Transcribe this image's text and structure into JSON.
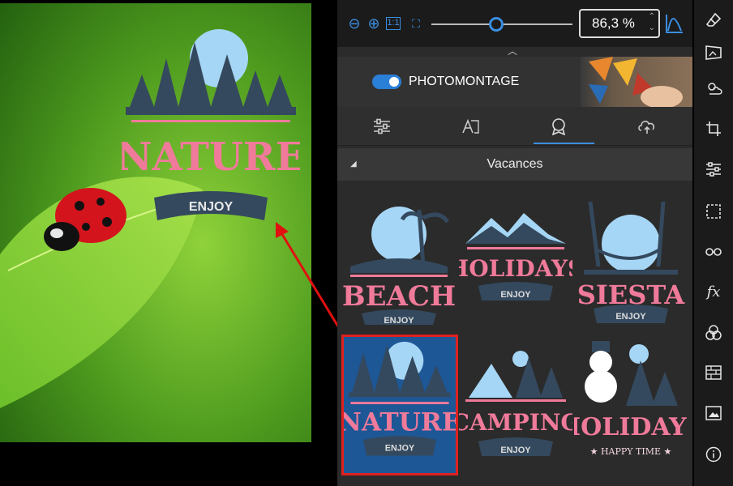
{
  "canvas": {
    "logo": {
      "title": "NATURE",
      "ribbon": "ENJOY"
    }
  },
  "zoom": {
    "value": "86,3 %"
  },
  "banner": {
    "label": "PHOTOMONTAGE",
    "toggle_on": true
  },
  "tabs": [
    {
      "icon": "sliders-icon"
    },
    {
      "icon": "text-icon"
    },
    {
      "icon": "badge-icon",
      "active": true
    },
    {
      "icon": "cloud-icon"
    }
  ],
  "section": {
    "title": "Vacances"
  },
  "stickers": [
    {
      "title": "BEACH",
      "ribbon": "ENJOY"
    },
    {
      "title": "HOLIDAYS",
      "ribbon": "ENJOY"
    },
    {
      "title": "SIESTA",
      "ribbon": "ENJOY"
    },
    {
      "title": "NATURE",
      "ribbon": "ENJOY",
      "selected": true
    },
    {
      "title": "CAMPING",
      "ribbon": "ENJOY"
    },
    {
      "title": "HOLIDAYS",
      "ribbon": "★ HAPPY TIME ★"
    }
  ],
  "toolbar": [
    "eraser-icon",
    "perspective-icon",
    "weather-icon",
    "crop-icon",
    "adjust-icon",
    "selection-icon",
    "glasses-icon",
    "fx-icon",
    "blend-icon",
    "texture-icon",
    "frame-icon",
    "info-icon"
  ],
  "colors": {
    "accent": "#3b8ee0",
    "sticker_pink": "#f07a9a",
    "sticker_dark": "#34495e",
    "selection": "#e02020"
  }
}
